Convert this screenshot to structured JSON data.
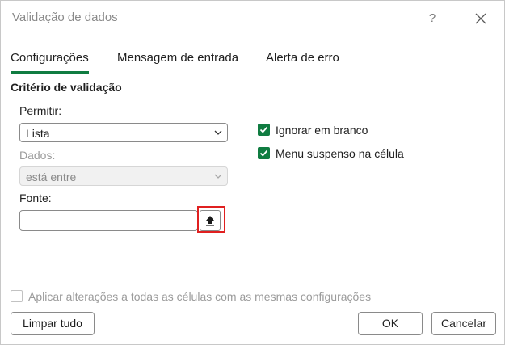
{
  "dialog": {
    "title": "Validação de dados",
    "help": "?",
    "close_icon": "close-icon"
  },
  "tabs": [
    {
      "label": "Configurações",
      "active": true
    },
    {
      "label": "Mensagem de entrada",
      "active": false
    },
    {
      "label": "Alerta de erro",
      "active": false
    }
  ],
  "criteria": {
    "section_title": "Critério de validação",
    "allow": {
      "label": "Permitir:",
      "value": "Lista"
    },
    "data": {
      "label": "Dados:",
      "value": "está entre",
      "disabled": true
    },
    "source": {
      "label": "Fonte:",
      "value": "",
      "button_icon": "collapse-dialog-icon"
    },
    "ignore_blank": {
      "label": "Ignorar em branco",
      "checked": true
    },
    "in_cell_dropdown": {
      "label": "Menu suspenso na célula",
      "checked": true
    }
  },
  "apply_all": {
    "label": "Aplicar alterações a todas as células com as mesmas configurações",
    "checked": false,
    "disabled": true
  },
  "buttons": {
    "clear_all": "Limpar tudo",
    "ok": "OK",
    "cancel": "Cancelar"
  },
  "colors": {
    "accent": "#107c41",
    "highlight": "#e02020"
  }
}
